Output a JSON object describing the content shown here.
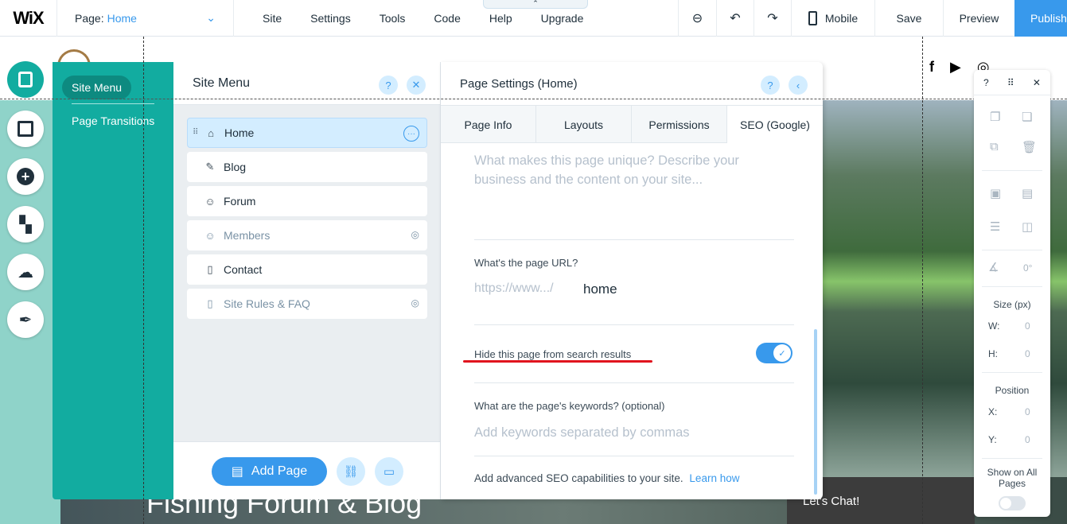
{
  "topbar": {
    "logo": "WiX",
    "page_label": "Page:",
    "page_value": "Home",
    "menu": [
      "Site",
      "Settings",
      "Tools",
      "Code",
      "Help",
      "Upgrade"
    ],
    "mobile_label": "Mobile",
    "save_label": "Save",
    "preview_label": "Preview",
    "publish_label": "Publish"
  },
  "site": {
    "hero_title": "Fishing Forum & Blog",
    "chat_label": "Let's Chat!",
    "socials": [
      "f",
      "▶",
      "◎"
    ]
  },
  "site_menu": {
    "active_label": "Site Menu",
    "page_transitions_label": "Page Transitions",
    "header_title": "Site Menu",
    "pages": [
      {
        "label": "Home",
        "icon": "home-icon",
        "glyph": "⌂"
      },
      {
        "label": "Blog",
        "icon": "pen-icon",
        "glyph": "✎"
      },
      {
        "label": "Forum",
        "icon": "people-icon",
        "glyph": "☺"
      },
      {
        "label": "Members",
        "icon": "people-icon",
        "glyph": "☺"
      },
      {
        "label": "Contact",
        "icon": "page-icon",
        "glyph": "▯"
      },
      {
        "label": "Site Rules & FAQ",
        "icon": "page-icon",
        "glyph": "▯"
      }
    ],
    "add_page_label": "Add Page"
  },
  "page_settings": {
    "title": "Page Settings (Home)",
    "tabs": [
      "Page Info",
      "Layouts",
      "Permissions",
      "SEO (Google)"
    ],
    "description_placeholder": "What makes this page unique? Describe your business and the content on your site...",
    "url_label": "What's the page URL?",
    "url_prefix": "https://www.../",
    "url_value": "home",
    "hide_label": "Hide this page from search results",
    "hide_enabled": true,
    "keywords_label": "What are the page's keywords? (optional)",
    "keywords_placeholder": "Add keywords separated by commas",
    "advanced_text": "Add advanced SEO capabilities to your site.",
    "learn_how": "Learn how"
  },
  "right_toolbar": {
    "help": "?",
    "angle_value": "0°",
    "size_label": "Size (px)",
    "w_label": "W:",
    "w_value": "0",
    "h_label": "H:",
    "h_value": "0",
    "position_label": "Position",
    "x_label": "X:",
    "x_value": "0",
    "y_label": "Y:",
    "y_value": "0",
    "show_all_label": "Show on All Pages"
  },
  "colors": {
    "accent": "#3899ec",
    "teal": "#12aca0",
    "highlight_red": "#e0141e"
  }
}
